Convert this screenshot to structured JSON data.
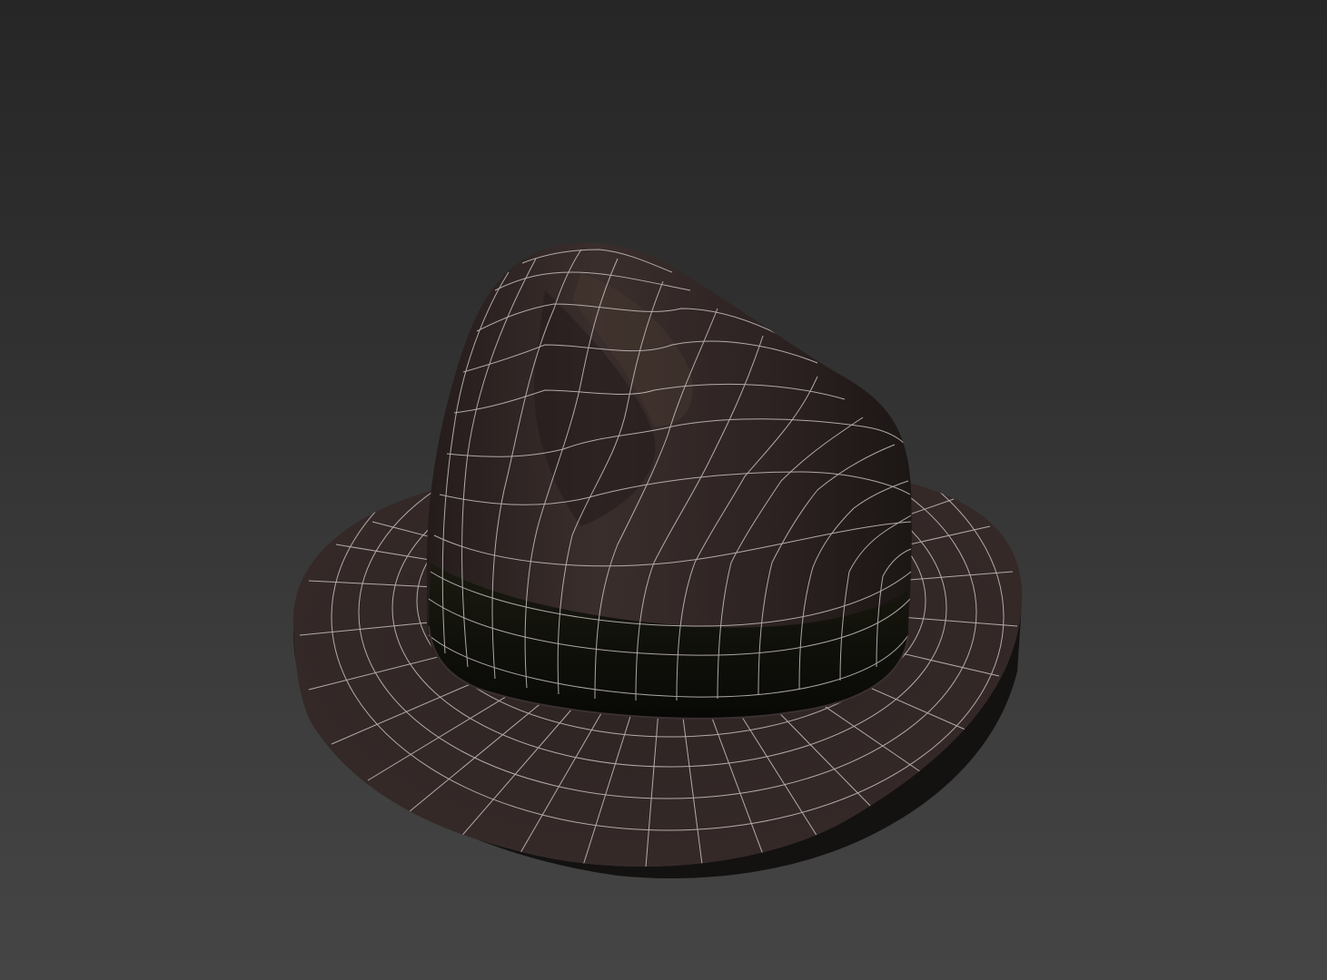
{
  "viewport": {
    "background_top": "#262626",
    "background_bottom": "#454545"
  },
  "model": {
    "name": "fedora-hat",
    "shading": "smooth-with-wireframe",
    "colors": {
      "felt": "#2e2423",
      "felt_highlight": "#3a2e2c",
      "felt_shadow": "#1e1716",
      "band": "#0d0d08",
      "wire": "#c9c2c2"
    }
  }
}
